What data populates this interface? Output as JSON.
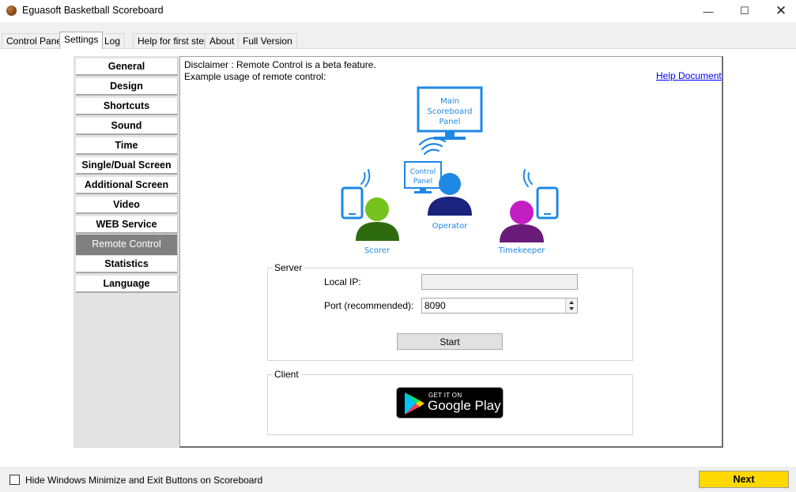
{
  "window": {
    "title": "Eguasoft Basketball Scoreboard",
    "minimize_glyph": "—",
    "maximize_glyph": "☐",
    "close_glyph": "✕"
  },
  "tabs": [
    {
      "label": "Control Panel"
    },
    {
      "label": "Settings"
    },
    {
      "label": "Log"
    },
    {
      "label": "Help for first step"
    },
    {
      "label": "About"
    },
    {
      "label": "Full Version"
    }
  ],
  "active_tab": "Settings",
  "nav": {
    "items": [
      {
        "label": "General"
      },
      {
        "label": "Design"
      },
      {
        "label": "Shortcuts"
      },
      {
        "label": "Sound"
      },
      {
        "label": "Time"
      },
      {
        "label": "Single/Dual Screen"
      },
      {
        "label": "Additional Screen"
      },
      {
        "label": "Video"
      },
      {
        "label": "WEB Service"
      },
      {
        "label": "Remote Control"
      },
      {
        "label": "Statistics"
      },
      {
        "label": "Language"
      }
    ],
    "active": "Remote Control"
  },
  "content": {
    "disclaimer": "Disclaimer : Remote Control is a beta feature.",
    "example": "Example usage of remote control:",
    "help_link": "Help Document"
  },
  "diagram": {
    "main_panel": [
      "Main",
      "Scoreboard",
      "Panel"
    ],
    "control_panel": [
      "Control",
      "Panel"
    ],
    "operator": "Operator",
    "scorer": "Scorer",
    "timekeeper": "Timekeeper",
    "colors": {
      "blue": "#1e88e5",
      "navy": "#1a237e",
      "green": "#76c21e",
      "dark_green": "#2e6b0f",
      "magenta": "#c21ec2",
      "purple": "#6a1b7a"
    }
  },
  "server": {
    "title": "Server",
    "local_ip_label": "Local IP:",
    "local_ip_value": "",
    "port_label": "Port (recommended):",
    "port_value": "8090",
    "start_label": "Start"
  },
  "client": {
    "title": "Client",
    "badge_small": "GET IT ON",
    "badge_big": "Google Play"
  },
  "bottom": {
    "hide_label": "Hide Windows Minimize and Exit Buttons on Scoreboard",
    "hide_checked": false,
    "next_label": "Next",
    "next_color": "#ffd800"
  }
}
